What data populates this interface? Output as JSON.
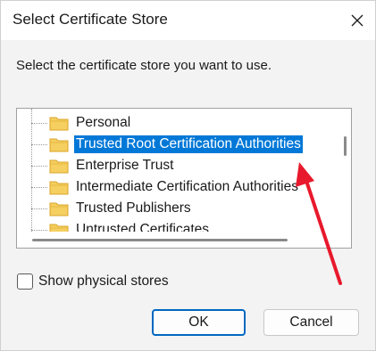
{
  "window": {
    "title": "Select Certificate Store",
    "close_icon": "close-icon"
  },
  "instruction": "Select the certificate store you want to use.",
  "tree": {
    "items": [
      {
        "label": "Personal",
        "selected": false
      },
      {
        "label": "Trusted Root Certification Authorities",
        "selected": true
      },
      {
        "label": "Enterprise Trust",
        "selected": false
      },
      {
        "label": "Intermediate Certification Authorities",
        "selected": false
      },
      {
        "label": "Trusted Publishers",
        "selected": false
      },
      {
        "label": "Untrusted Certificates",
        "selected": false
      }
    ]
  },
  "checkbox": {
    "label": "Show physical stores",
    "checked": false
  },
  "buttons": {
    "ok": "OK",
    "cancel": "Cancel"
  },
  "colors": {
    "selection": "#0078d7",
    "annotation_arrow": "#e8192c",
    "default_button_border": "#0067c0"
  }
}
